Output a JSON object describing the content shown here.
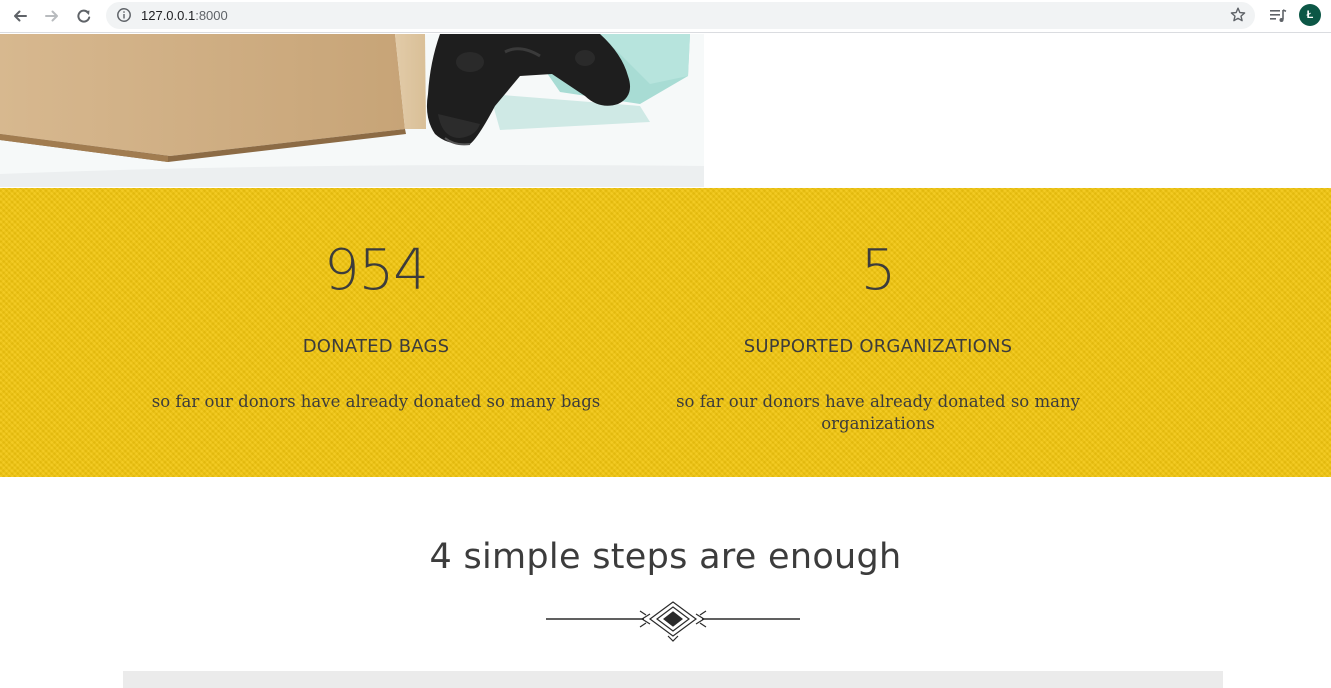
{
  "browser": {
    "url_host": "127.0.0.1",
    "url_port": ":8000",
    "avatar_letter": "Ł",
    "avatar_color": "#0c5746"
  },
  "stats": {
    "background_color": "#f2c60f",
    "items": [
      {
        "number": "954",
        "label": "DONATED BAGS",
        "description": "so far our donors have already donated so many bags"
      },
      {
        "number": "5",
        "label": "SUPPORTED ORGANIZATIONS",
        "description": "so far our donors have already donated so many organizations"
      }
    ]
  },
  "steps": {
    "title": "4 simple steps are enough"
  }
}
